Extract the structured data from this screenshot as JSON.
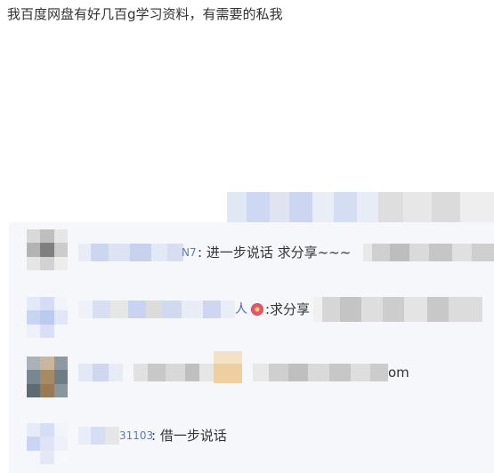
{
  "post": {
    "text": "我百度网盘有好几百g学习资料，有需要的私我"
  },
  "comments": [
    {
      "nick_tail": "N7",
      "text": ": 进一步说话 求分享~~~"
    },
    {
      "nick_tail": "人",
      "icon": "flower-icon",
      "text": ":求分享"
    },
    {
      "text": "om"
    },
    {
      "nick_tail": "31103",
      "text": ": 借一步说话"
    }
  ]
}
